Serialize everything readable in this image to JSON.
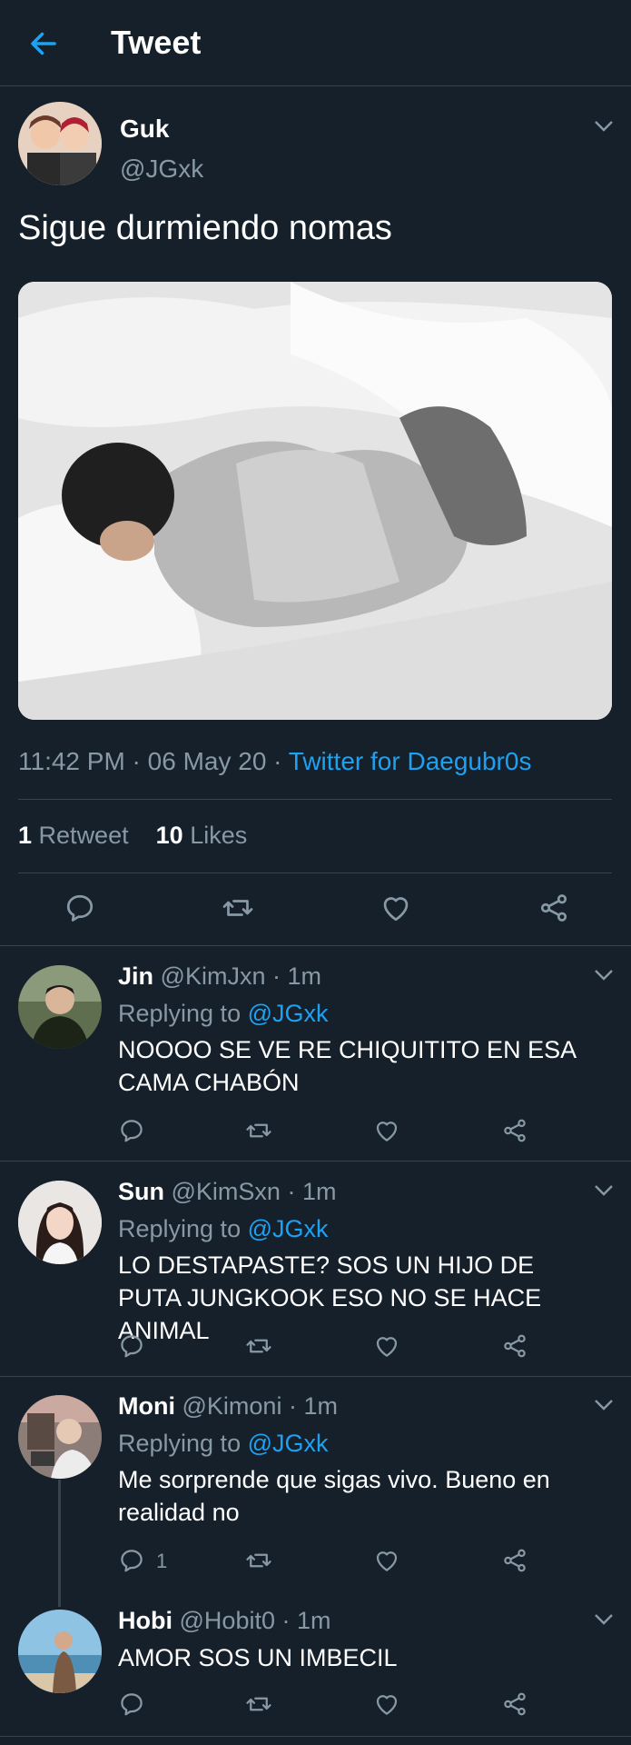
{
  "header": {
    "title": "Tweet"
  },
  "tweet": {
    "name": "Guk",
    "handle": "@JGxk",
    "text": "Sigue durmiendo nomas",
    "time": "11:42 PM · 06 May 20 · ",
    "source": "Twitter for Daegubr0s",
    "retweets_count": "1",
    "retweets_label": "Retweet",
    "likes_count": "10",
    "likes_label": "Likes"
  },
  "replies": [
    {
      "name": "Jin",
      "handle": "@KimJxn",
      "time": "· 1m",
      "replying_label": "Replying to",
      "replying_to": "@JGxk",
      "text": "NOOOO SE VE RE CHIQUITITO EN ESA CAMA CHABÓN"
    },
    {
      "name": "Sun",
      "handle": "@KimSxn",
      "time": "· 1m",
      "replying_label": "Replying to",
      "replying_to": "@JGxk",
      "text": "LO DESTAPASTE? SOS UN HIJO DE PUTA JUNGKOOK ESO NO SE HACE ANIMAL"
    },
    {
      "name": "Moni",
      "handle": "@Kimoni",
      "time": "· 1m",
      "replying_label": "Replying to",
      "replying_to": "@JGxk",
      "text": "Me sorprende que sigas vivo. Bueno en realidad no",
      "reply_count": "1"
    },
    {
      "name": "Hobi",
      "handle": "@Hobit0",
      "time": "· 1m",
      "text": "AMOR SOS UN IMBECIL"
    }
  ],
  "colors": {
    "background": "#15202b",
    "accent": "#1da1f2",
    "muted": "#8899a6",
    "divider": "#38444d"
  },
  "icons": [
    "back-arrow-icon",
    "chevron-down-icon",
    "reply-icon",
    "retweet-icon",
    "like-icon",
    "share-icon"
  ]
}
